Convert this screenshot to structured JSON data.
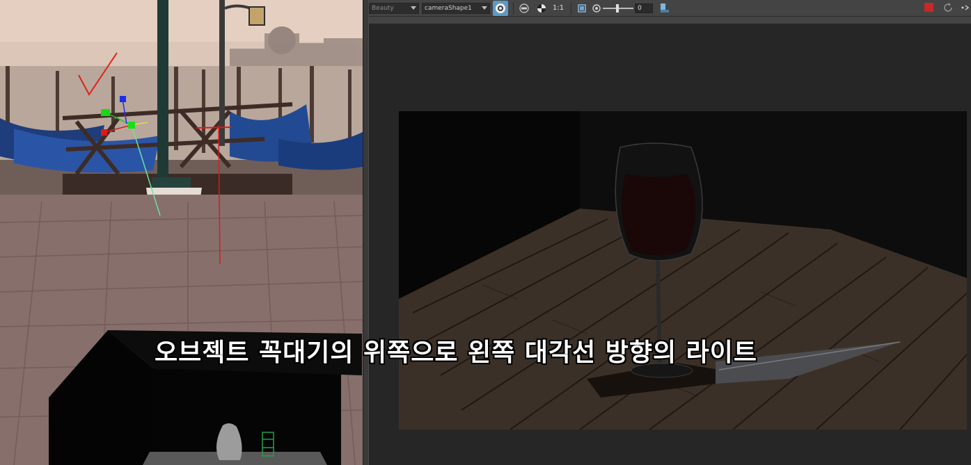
{
  "render_view": {
    "toolbar": {
      "aov_dropdown": "Beauty",
      "camera_dropdown": "cameraShape1",
      "ratio_label": "1:1",
      "exposure_value": "0"
    },
    "colors": {
      "toolbar_bg": "#444444",
      "render_bg": "#262626",
      "active_icon": "#5d9ac5",
      "stop_red": "#c8282a"
    }
  },
  "viewport": {
    "icons": [
      "move-manipulator-icon",
      "light-locator-icon",
      "annotation-checkmark"
    ]
  },
  "caption": {
    "text": "오브젝트 꼭대기의 위쪽으로 왼쪽 대각선 방향의 라이트"
  }
}
